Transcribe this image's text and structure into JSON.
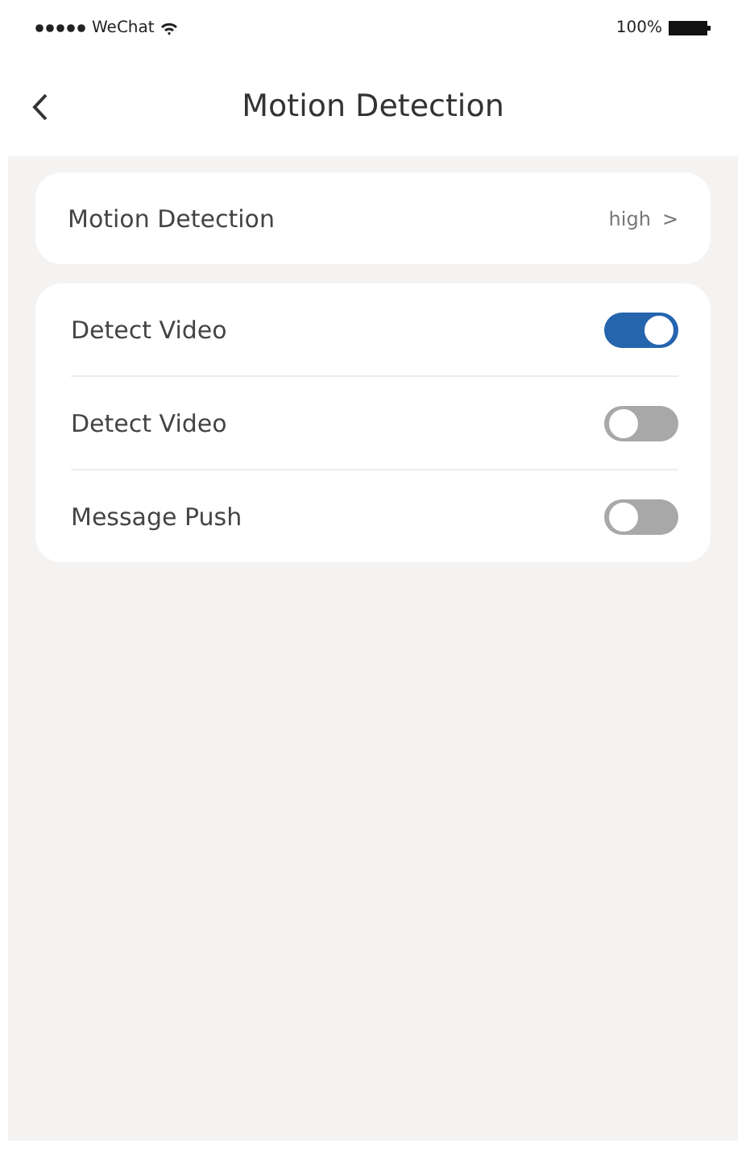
{
  "status_bar": {
    "carrier": "WeChat",
    "battery": "100%"
  },
  "nav_bar": {
    "title": "Motion Detection"
  },
  "sensitivity": {
    "label": "Motion Detection",
    "value": "high",
    "chevron": ">"
  },
  "switches": [
    {
      "label": "Detect Video",
      "on": true
    },
    {
      "label": "Detect Video",
      "on": false
    },
    {
      "label": "Message Push",
      "on": false
    }
  ]
}
